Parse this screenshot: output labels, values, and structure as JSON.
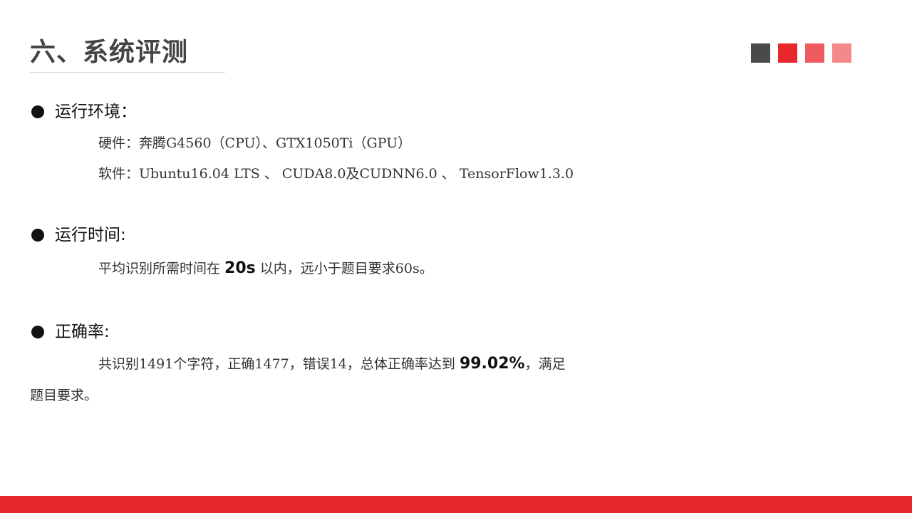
{
  "title": "六、系统评测",
  "colors": {
    "squares": [
      "#4a4a4a",
      "#e8282d",
      "#ee5a5e",
      "#f28a8b"
    ],
    "footer": "#e8282d"
  },
  "sections": {
    "env": {
      "heading": "运行环境：",
      "hardware": "硬件：奔腾G4560（CPU）、GTX1050Ti（GPU）",
      "software": "软件：Ubuntu16.04 LTS 、 CUDA8.0及CUDNN6.0 、 TensorFlow1.3.0"
    },
    "time": {
      "heading": "运行时间:",
      "prefix": "平均识别所需时间在 ",
      "value": "20s",
      "suffix": " 以内，远小于题目要求60s。"
    },
    "accuracy": {
      "heading": "正确率:",
      "prefix": "共识别1491个字符，正确1477，错误14，总体正确率达到 ",
      "value": "99.02%",
      "suffix": "，满足",
      "continuation": "题目要求。"
    }
  }
}
